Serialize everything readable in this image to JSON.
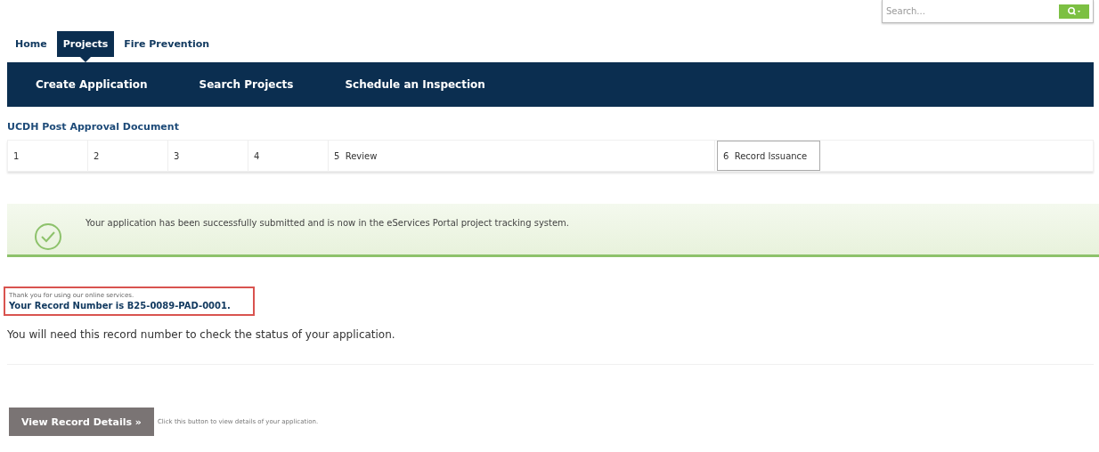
{
  "search": {
    "placeholder": "Search..."
  },
  "tabs": [
    {
      "label": "Home",
      "selected": false
    },
    {
      "label": "Projects",
      "selected": true
    },
    {
      "label": "Fire Prevention",
      "selected": false
    }
  ],
  "menu": [
    "Create Application",
    "Search Projects",
    "Schedule an Inspection"
  ],
  "page_title": "UCDH Post Approval Document",
  "steps": [
    {
      "number": "1",
      "selected": false
    },
    {
      "number": "2",
      "selected": false
    },
    {
      "number": "3",
      "selected": false
    },
    {
      "number": "4",
      "selected": false
    },
    {
      "number": "5",
      "label": "Review",
      "selected": false
    },
    {
      "number": "6",
      "label": "Record Issuance",
      "selected": true
    }
  ],
  "success_message": "Your application has been successfully submitted and is now in the eServices Portal project tracking system.",
  "thanks": "Thank you for using our online services.",
  "record_number": "Your Record Number is B25-0089-PAD-0001.",
  "note": "You will need this record number to check the status of your application.",
  "view_button": "View Record Details »",
  "view_hint": "Click this button to view details of your application."
}
